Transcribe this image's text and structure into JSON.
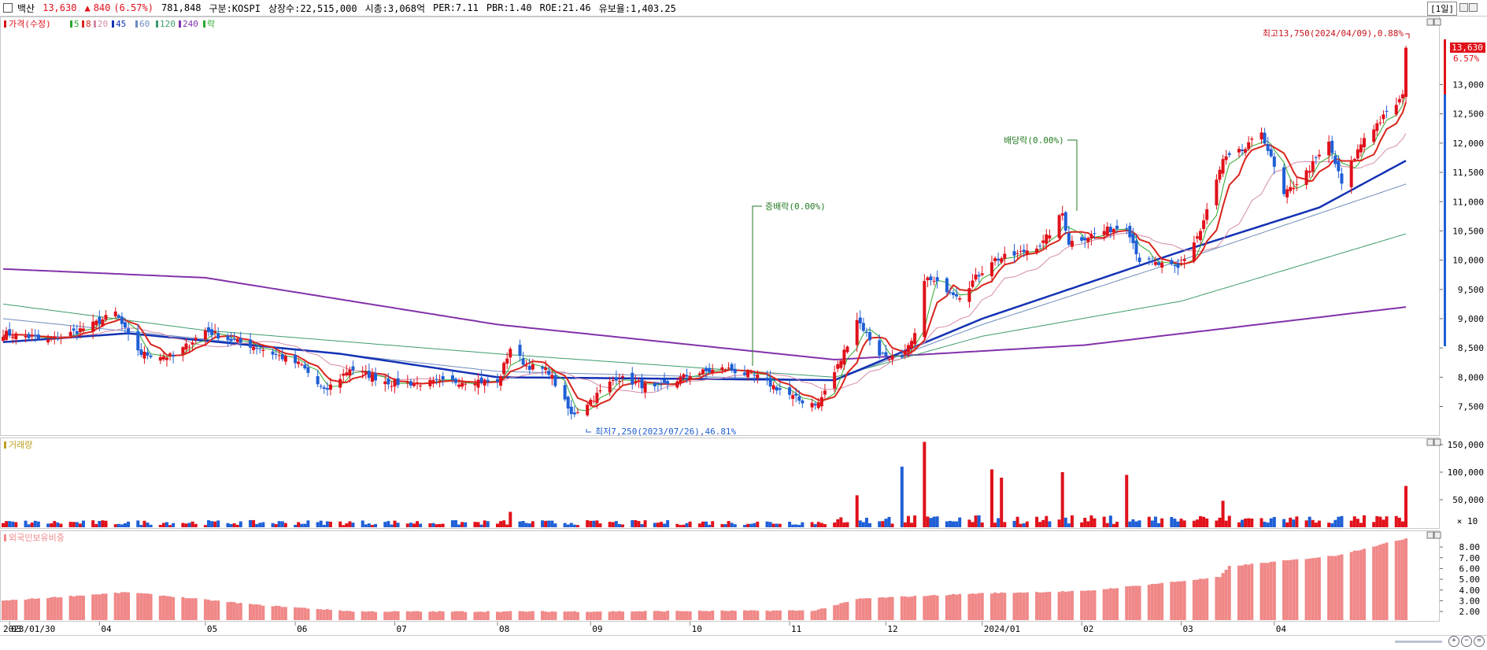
{
  "header": {
    "stock_name": "백산",
    "price": "13,630",
    "change_arrow": "▲",
    "change": "840",
    "change_pct": "(6.57%)",
    "volume": "781,848",
    "market": "구분:KOSPI",
    "shares": "상장수:22,515,000",
    "market_cap": "시총:3,068억",
    "per": "PER:7.11",
    "pbr": "PBR:1.40",
    "roe": "ROE:21.46",
    "retention": "유보율:1,403.25",
    "period": "[1일]"
  },
  "colors": {
    "up": "#e0111a",
    "down": "#1f5fd6",
    "ma5": "#2ea82e",
    "ma8": "#d9261c",
    "ma20": "#d68aa8",
    "ma45": "#1432b4",
    "ma60": "#6e8cbe",
    "ma120": "#3c9c6c",
    "ma240": "#8232aa",
    "foreign": "#f08888"
  },
  "chart_data": [
    {
      "type": "candlestick",
      "title": "",
      "legend": [
        {
          "label": "가격(수정)",
          "color": "#e0111a"
        },
        {
          "label": "5",
          "color": "#2ea82e"
        },
        {
          "label": "8",
          "color": "#d9261c"
        },
        {
          "label": "20",
          "color": "#d68aa8"
        },
        {
          "label": "45",
          "color": "#1432b4"
        },
        {
          "label": "60",
          "color": "#6e8cbe"
        },
        {
          "label": "120",
          "color": "#3c9c6c"
        },
        {
          "label": "240",
          "color": "#8232aa"
        },
        {
          "label": "락",
          "color": "#2ea82e"
        }
      ],
      "x_tick_labels": [
        "2023/01/30",
        "03",
        "04",
        "05",
        "06",
        "07",
        "08",
        "09",
        "10",
        "11",
        "12",
        "2024/01",
        "02",
        "03",
        "04"
      ],
      "y_tick_labels": [
        "13,000",
        "12,500",
        "12,000",
        "11,500",
        "11,000",
        "10,500",
        "10,000",
        "9,500",
        "9,000",
        "8,500",
        "8,000",
        "7,500"
      ],
      "y_ticks": [
        13000,
        12500,
        12000,
        11500,
        11000,
        10500,
        10000,
        9500,
        9000,
        8500,
        8000,
        7500
      ],
      "ylim": [
        7050,
        14150
      ],
      "x_range": [
        "2023-01-30",
        "2024-04-11"
      ],
      "current_price": 13630,
      "current_price_label": "13,630",
      "current_change_label": "6.57%",
      "annotations": {
        "high": "최고13,750(2024/04/09),0.88%",
        "low": "최저7,250(2023/07/26),46.81%",
        "event1": "증배락(0.00%)",
        "event2": "배당락(0.00%)"
      },
      "anchor_points": [
        {
          "x": "2023-01-30",
          "close": 8750
        },
        {
          "x": "2023-02-06",
          "close": 8700
        },
        {
          "x": "2023-02-13",
          "close": 8620
        },
        {
          "x": "2023-02-20",
          "close": 8750
        },
        {
          "x": "2023-02-27",
          "close": 8900
        },
        {
          "x": "2023-03-06",
          "close": 9100
        },
        {
          "x": "2023-03-10",
          "close": 8700
        },
        {
          "x": "2023-03-14",
          "close": 8400
        },
        {
          "x": "2023-03-24",
          "close": 8350
        },
        {
          "x": "2023-04-03",
          "close": 8800
        },
        {
          "x": "2023-04-10",
          "close": 8650
        },
        {
          "x": "2023-04-20",
          "close": 8500
        },
        {
          "x": "2023-05-03",
          "close": 8200
        },
        {
          "x": "2023-05-10",
          "close": 7750
        },
        {
          "x": "2023-05-18",
          "close": 8150
        },
        {
          "x": "2023-05-31",
          "close": 7900
        },
        {
          "x": "2023-06-12",
          "close": 7900
        },
        {
          "x": "2023-06-26",
          "close": 7950
        },
        {
          "x": "2023-07-03",
          "close": 7900
        },
        {
          "x": "2023-07-07",
          "close": 8500
        },
        {
          "x": "2023-07-12",
          "close": 8200
        },
        {
          "x": "2023-07-19",
          "close": 8100
        },
        {
          "x": "2023-07-26",
          "close": 7350
        },
        {
          "x": "2023-08-02",
          "close": 7650
        },
        {
          "x": "2023-08-09",
          "close": 8000
        },
        {
          "x": "2023-08-21",
          "close": 7800
        },
        {
          "x": "2023-09-01",
          "close": 8050
        },
        {
          "x": "2023-09-12",
          "close": 8150
        },
        {
          "x": "2023-09-22",
          "close": 8000
        },
        {
          "x": "2023-10-05",
          "close": 7600
        },
        {
          "x": "2023-10-11",
          "close": 7550
        },
        {
          "x": "2023-10-18",
          "close": 8300
        },
        {
          "x": "2023-10-23",
          "close": 9000
        },
        {
          "x": "2023-10-30",
          "close": 8400
        },
        {
          "x": "2023-11-06",
          "close": 8300
        },
        {
          "x": "2023-11-10",
          "close": 8700
        },
        {
          "x": "2023-11-13",
          "close": 9700
        },
        {
          "x": "2023-11-24",
          "close": 9400
        },
        {
          "x": "2023-12-04",
          "close": 10000
        },
        {
          "x": "2023-12-12",
          "close": 10100
        },
        {
          "x": "2023-12-20",
          "close": 10300
        },
        {
          "x": "2023-12-26",
          "close": 10800
        },
        {
          "x": "2023-12-28",
          "close": 10300
        },
        {
          "x": "2024-01-08",
          "close": 10500
        },
        {
          "x": "2024-01-15",
          "close": 10600
        },
        {
          "x": "2024-01-19",
          "close": 10000
        },
        {
          "x": "2024-01-31",
          "close": 9850
        },
        {
          "x": "2024-02-07",
          "close": 10500
        },
        {
          "x": "2024-02-14",
          "close": 11700
        },
        {
          "x": "2024-02-21",
          "close": 11900
        },
        {
          "x": "2024-02-26",
          "close": 12200
        },
        {
          "x": "2024-03-04",
          "close": 11100
        },
        {
          "x": "2024-03-11",
          "close": 11500
        },
        {
          "x": "2024-03-18",
          "close": 12000
        },
        {
          "x": "2024-03-22",
          "close": 11300
        },
        {
          "x": "2024-03-29",
          "close": 12100
        },
        {
          "x": "2024-04-05",
          "close": 12500
        },
        {
          "x": "2024-04-10",
          "close": 12790
        },
        {
          "x": "2024-04-11",
          "close": 13630
        }
      ],
      "ma_levels": [
        {
          "name": "240",
          "points": [
            {
              "x": "2023-01-30",
              "y": 9850
            },
            {
              "x": "2023-04-03",
              "y": 9700
            },
            {
              "x": "2023-07-03",
              "y": 8900
            },
            {
              "x": "2023-10-16",
              "y": 8300
            },
            {
              "x": "2024-01-02",
              "y": 8550
            },
            {
              "x": "2024-04-11",
              "y": 9200
            }
          ]
        },
        {
          "name": "120",
          "points": [
            {
              "x": "2023-01-30",
              "y": 9250
            },
            {
              "x": "2023-04-03",
              "y": 8800
            },
            {
              "x": "2023-07-03",
              "y": 8400
            },
            {
              "x": "2023-10-16",
              "y": 8000
            },
            {
              "x": "2023-12-01",
              "y": 8700
            },
            {
              "x": "2024-02-01",
              "y": 9300
            },
            {
              "x": "2024-04-11",
              "y": 10450
            }
          ]
        },
        {
          "name": "60",
          "points": [
            {
              "x": "2023-01-30",
              "y": 9000
            },
            {
              "x": "2023-04-03",
              "y": 8650
            },
            {
              "x": "2023-07-03",
              "y": 8100
            },
            {
              "x": "2023-10-16",
              "y": 7950
            },
            {
              "x": "2023-12-01",
              "y": 8900
            },
            {
              "x": "2024-02-01",
              "y": 10000
            },
            {
              "x": "2024-04-11",
              "y": 11300
            }
          ]
        },
        {
          "name": "45",
          "points": [
            {
              "x": "2023-01-30",
              "y": 8600
            },
            {
              "x": "2023-03-10",
              "y": 8750
            },
            {
              "x": "2023-05-15",
              "y": 8400
            },
            {
              "x": "2023-07-03",
              "y": 8000
            },
            {
              "x": "2023-10-16",
              "y": 7950
            },
            {
              "x": "2023-12-01",
              "y": 9000
            },
            {
              "x": "2024-02-01",
              "y": 10150
            },
            {
              "x": "2024-03-15",
              "y": 10900
            },
            {
              "x": "2024-04-11",
              "y": 11700
            }
          ]
        }
      ]
    },
    {
      "type": "bar",
      "title": "거래량",
      "y_tick_labels": [
        "150,000",
        "100,000",
        "50,000"
      ],
      "y_ticks": [
        150000,
        100000,
        50000
      ],
      "ylim": [
        0,
        160000
      ],
      "unit_label": "× 10",
      "spikes": [
        {
          "x": "2023-07-07",
          "value": 28000
        },
        {
          "x": "2023-10-23",
          "value": 58000
        },
        {
          "x": "2023-11-06",
          "value": 110000
        },
        {
          "x": "2023-11-13",
          "value": 155000
        },
        {
          "x": "2023-12-04",
          "value": 105000
        },
        {
          "x": "2023-12-07",
          "value": 90000
        },
        {
          "x": "2023-12-26",
          "value": 100000
        },
        {
          "x": "2024-01-15",
          "value": 95000
        },
        {
          "x": "2024-02-14",
          "value": 48000
        },
        {
          "x": "2024-04-11",
          "value": 75000
        }
      ]
    },
    {
      "type": "bar",
      "title": "외국인보유비중",
      "y_tick_labels": [
        "8.00",
        "7.00",
        "6.00",
        "5.00",
        "4.00",
        "3.00",
        "2.00"
      ],
      "y_ticks": [
        8,
        7,
        6,
        5,
        4,
        3,
        2
      ],
      "ylim": [
        1.2,
        9.4
      ],
      "levels": [
        {
          "x": "2023-01-30",
          "y": 3.0
        },
        {
          "x": "2023-03-10",
          "y": 3.8
        },
        {
          "x": "2023-04-20",
          "y": 2.6
        },
        {
          "x": "2023-05-20",
          "y": 2.0
        },
        {
          "x": "2023-08-01",
          "y": 2.0
        },
        {
          "x": "2023-10-10",
          "y": 2.1
        },
        {
          "x": "2023-10-24",
          "y": 3.2
        },
        {
          "x": "2023-12-01",
          "y": 3.7
        },
        {
          "x": "2024-01-02",
          "y": 3.9
        },
        {
          "x": "2024-02-13",
          "y": 5.2
        },
        {
          "x": "2024-02-16",
          "y": 6.2
        },
        {
          "x": "2024-03-20",
          "y": 7.2
        },
        {
          "x": "2024-04-11",
          "y": 8.8
        }
      ]
    }
  ]
}
